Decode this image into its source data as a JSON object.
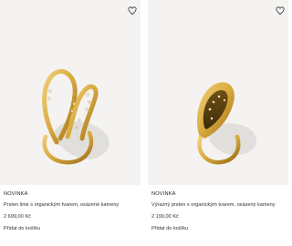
{
  "products": [
    {
      "badge": "NOVINKA",
      "title": "Prsten linie s organickým tvarem, osázené kameny",
      "price": "2 699,00 Kč",
      "cart_label": "Přidat do košíku",
      "wishlist_icon": "heart-icon"
    },
    {
      "badge": "NOVINKA",
      "title": "Výrazný prsten s organickým tvarem, osázený kameny",
      "price": "2 199,00 Kč",
      "cart_label": "Přidat do košíku",
      "wishlist_icon": "heart-icon"
    }
  ],
  "colors": {
    "image_background": "#f4f3f1",
    "gold": "#d9a93e",
    "gold_dark": "#a8781e",
    "text": "#333333"
  }
}
